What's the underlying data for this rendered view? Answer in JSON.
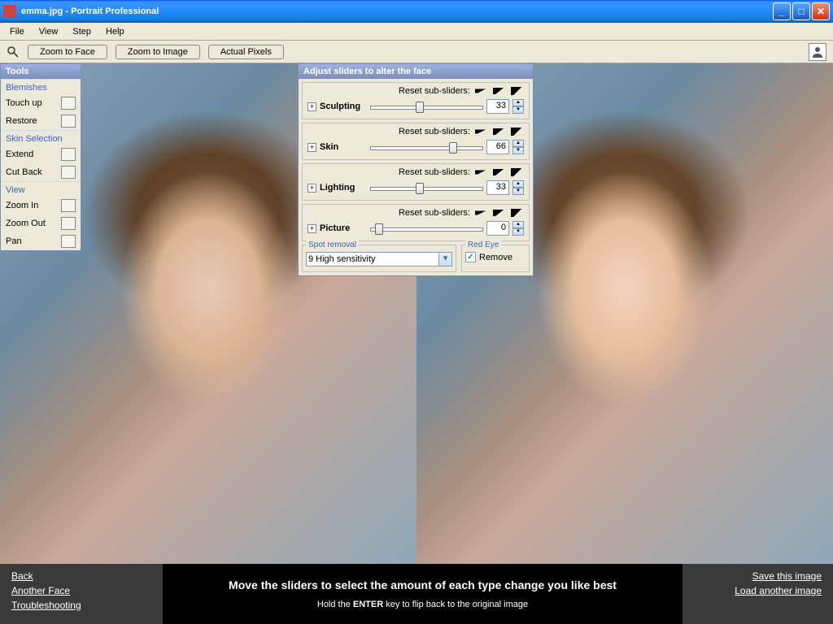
{
  "window": {
    "title": "emma.jpg - Portrait Professional"
  },
  "menu": {
    "file": "File",
    "view": "View",
    "step": "Step",
    "help": "Help"
  },
  "toolbar": {
    "zoom_face": "Zoom to Face",
    "zoom_image": "Zoom to Image",
    "actual_pixels": "Actual Pixels"
  },
  "tools": {
    "header": "Tools",
    "blemishes": "Blemishes",
    "touchup": "Touch up",
    "restore": "Restore",
    "skinsel": "Skin Selection",
    "extend": "Extend",
    "cutback": "Cut Back",
    "view": "View",
    "zoomin": "Zoom In",
    "zoomout": "Zoom Out",
    "pan": "Pan"
  },
  "adjust": {
    "header": "Adjust sliders to alter the face",
    "reset": "Reset sub-sliders:",
    "sliders": [
      {
        "name": "Sculpting",
        "value": "33",
        "pos": 40
      },
      {
        "name": "Skin",
        "value": "66",
        "pos": 70
      },
      {
        "name": "Lighting",
        "value": "33",
        "pos": 40
      },
      {
        "name": "Picture",
        "value": "0",
        "pos": 4
      }
    ],
    "spot": {
      "label": "Spot removal",
      "value": "9 High sensitivity"
    },
    "redeye": {
      "label": "Red Eye",
      "remove": "Remove"
    }
  },
  "footer": {
    "back": "Back",
    "another": "Another Face",
    "trouble": "Troubleshooting",
    "main": "Move the sliders to select the amount of each type change you like best",
    "sub_pre": "Hold the ",
    "sub_key": "ENTER",
    "sub_post": " key to flip back to the original image",
    "save": "Save this image",
    "load": "Load another image"
  }
}
